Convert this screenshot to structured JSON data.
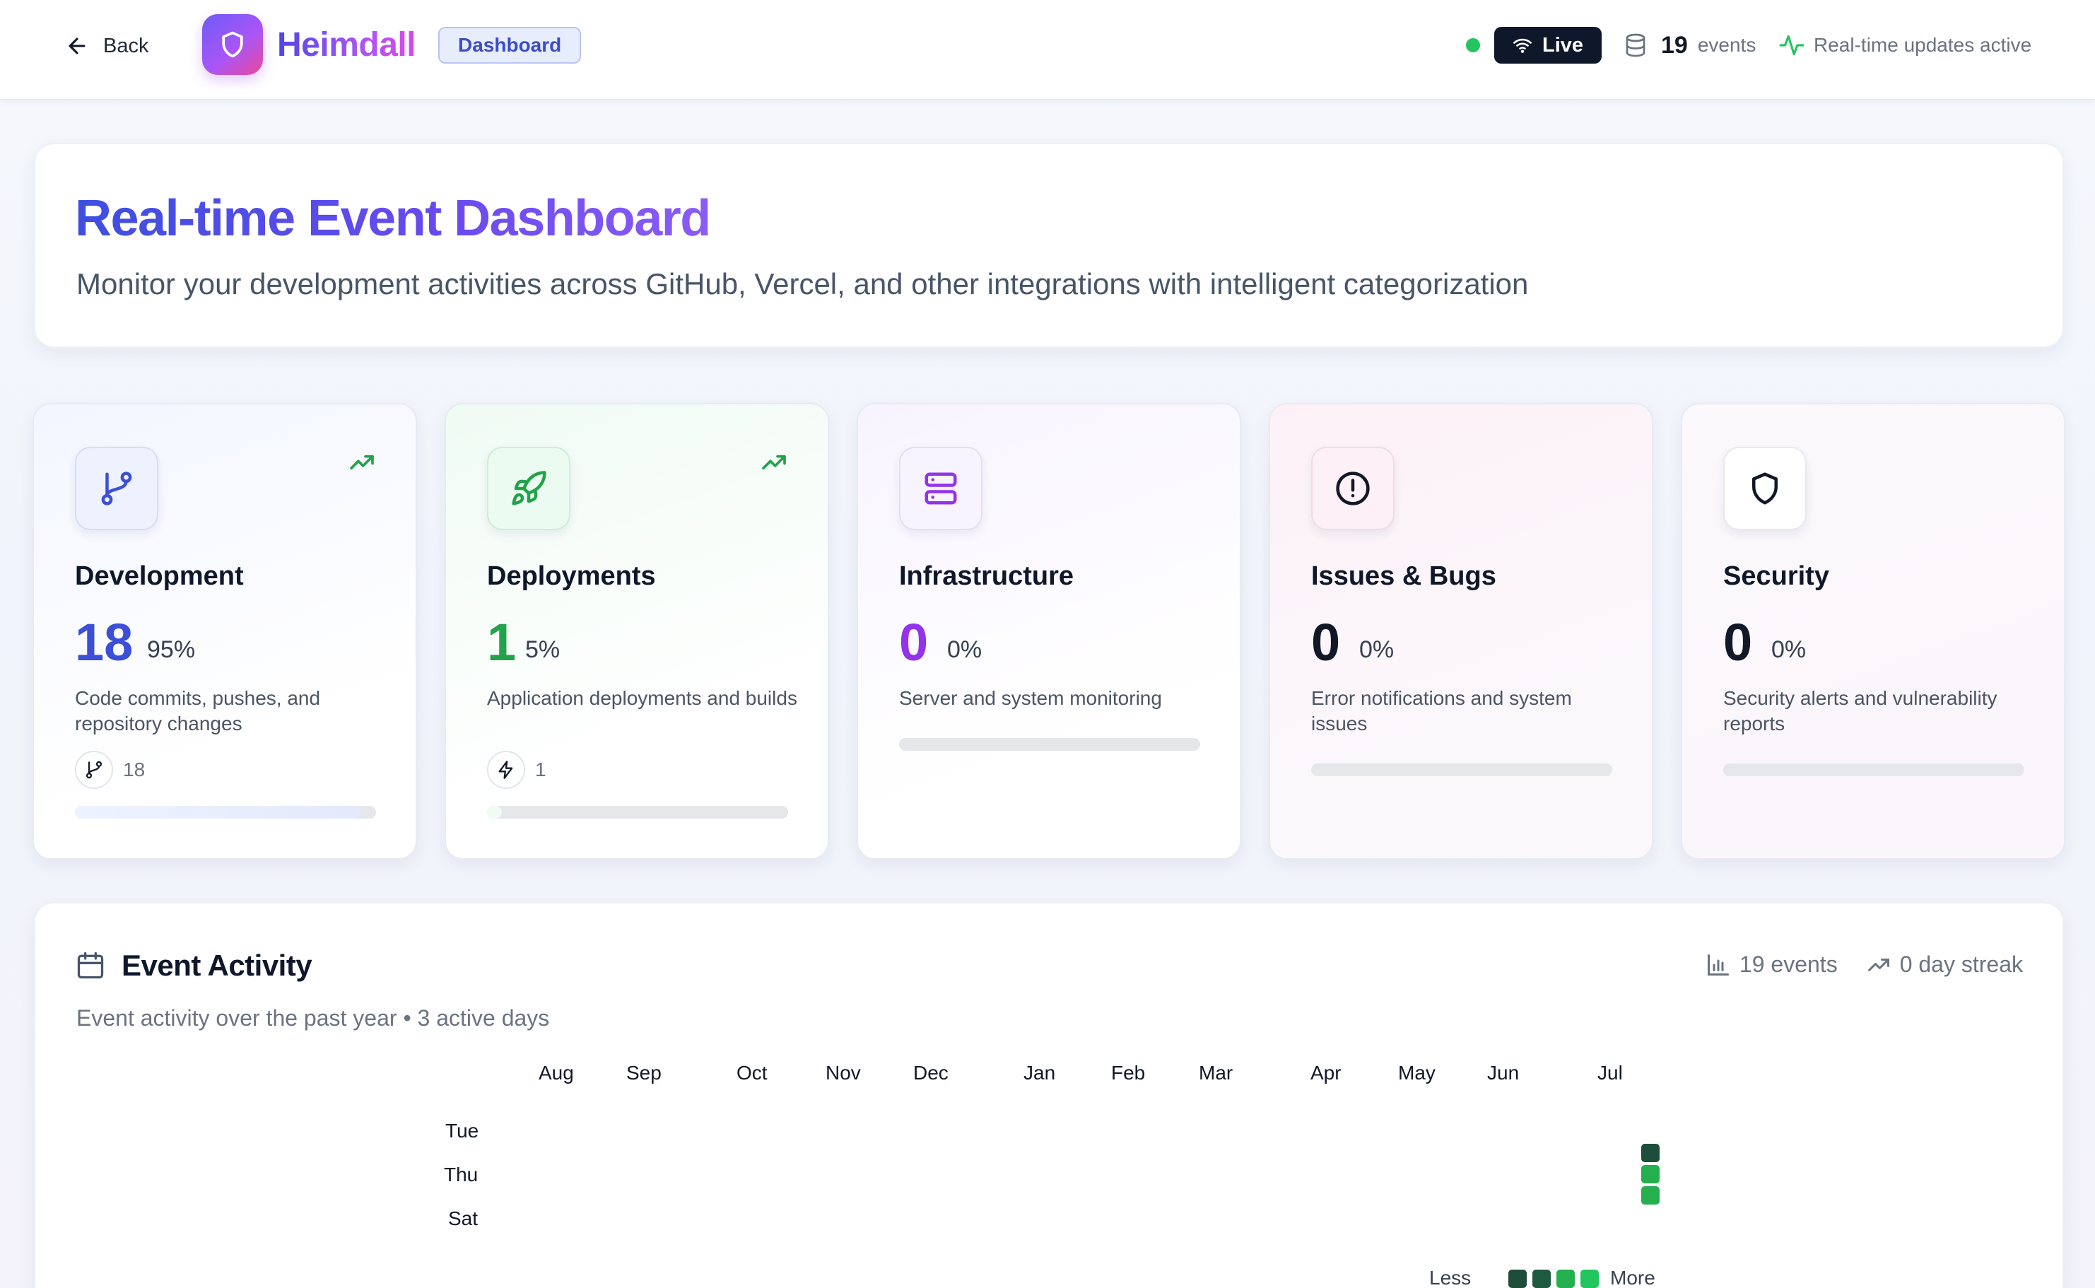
{
  "header": {
    "back_label": "Back",
    "brand": "Heimdall",
    "breadcrumb": "Dashboard",
    "live_label": "Live",
    "event_count": "19",
    "event_unit": "events",
    "realtime_status": "Real-time updates active",
    "status_color": "#22c55e"
  },
  "hero": {
    "title": "Real-time Event Dashboard",
    "subtitle": "Monitor your development activities across GitHub, Vercel, and other integrations with intelligent categorization"
  },
  "cards": [
    {
      "title": "Development",
      "count": "18",
      "percent": "95%",
      "description": "Code commits, pushes, and repository changes",
      "sub_count": "18",
      "accent": "#3b4fd8",
      "progress": 0.95,
      "icon": "git-branch-icon"
    },
    {
      "title": "Deployments",
      "count": "1",
      "percent": "5%",
      "description": "Application deployments and builds",
      "sub_count": "1",
      "accent": "#22a34a",
      "progress": 0.05,
      "icon": "rocket-icon"
    },
    {
      "title": "Infrastructure",
      "count": "0",
      "percent": "0%",
      "description": "Server and system monitoring",
      "accent": "#9333ea",
      "progress": 0,
      "icon": "server-icon"
    },
    {
      "title": "Issues & Bugs",
      "count": "0",
      "percent": "0%",
      "description": "Error notifications and system issues",
      "accent": "#111827",
      "progress": 0,
      "icon": "alert-circle-icon"
    },
    {
      "title": "Security",
      "count": "0",
      "percent": "0%",
      "description": "Security alerts and vulnerability reports",
      "accent": "#111827",
      "progress": 0,
      "icon": "shield-icon"
    }
  ],
  "activity": {
    "title": "Event Activity",
    "subtitle": "Event activity over the past year • 3 active days",
    "total_events": "19 events",
    "streak": "0 day streak",
    "months": [
      "Aug",
      "Sep",
      "Oct",
      "Nov",
      "Dec",
      "Jan",
      "Feb",
      "Mar",
      "Apr",
      "May",
      "Jun",
      "Jul"
    ],
    "day_labels": [
      "Tue",
      "Thu",
      "Sat"
    ],
    "active_cells": [
      {
        "month": "Jul",
        "weekday": "Wed",
        "level": 4
      },
      {
        "month": "Jul",
        "weekday": "Thu",
        "level": 2
      },
      {
        "month": "Jul",
        "weekday": "Fri",
        "level": 2
      }
    ],
    "legend_less": "Less",
    "legend_more": "More",
    "legend_colors": [
      "#1f4d3b",
      "#1e5a3f",
      "#25b04f",
      "#22c55e"
    ]
  }
}
